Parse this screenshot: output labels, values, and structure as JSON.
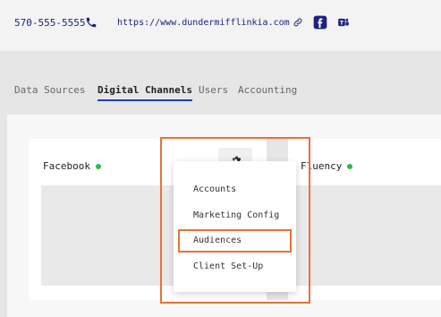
{
  "header": {
    "phone": "570-555-5555",
    "url": "https://www.dundermifflinkia.com",
    "icons": [
      "phone-icon",
      "link-icon",
      "facebook-icon",
      "teams-icon"
    ],
    "accent_color": "#1a237e"
  },
  "tabs": [
    {
      "label": "Data Sources",
      "active": false
    },
    {
      "label": "Digital Channels",
      "active": true
    },
    {
      "label": "Users",
      "active": false
    },
    {
      "label": "Accounting",
      "active": false
    }
  ],
  "cards": [
    {
      "title": "Facebook",
      "status": "green"
    },
    {
      "title": "Fluency",
      "status": "green"
    }
  ],
  "menu": {
    "icon": "gear-icon",
    "items": [
      "Accounts",
      "Marketing Config",
      "Audiences",
      "Client Set-Up"
    ],
    "highlighted": "Audiences",
    "highlight_color": "#e8713a"
  },
  "colors": {
    "status_green": "#2fb84b",
    "active_tab_underline": "#1a3fbf"
  }
}
